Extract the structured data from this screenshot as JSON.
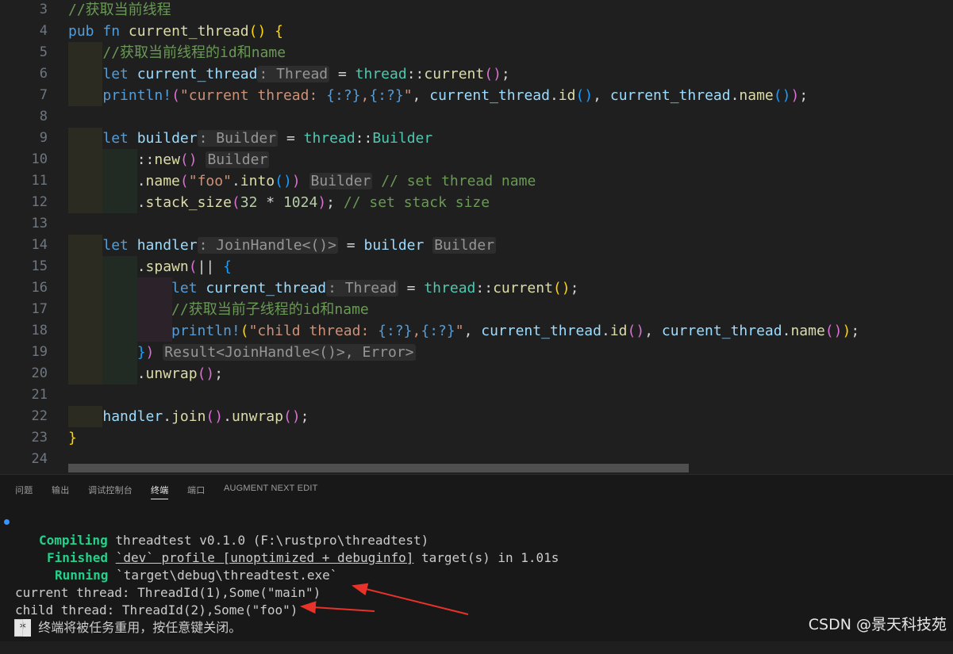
{
  "editor": {
    "lines": [
      {
        "n": "3",
        "tokens": [
          {
            "t": "//获取当前线程",
            "c": "cm"
          }
        ]
      },
      {
        "n": "4",
        "tokens": [
          {
            "t": "pub",
            "c": "kw"
          },
          {
            "t": " ",
            "c": "op"
          },
          {
            "t": "fn",
            "c": "kw"
          },
          {
            "t": " ",
            "c": "op"
          },
          {
            "t": "current_thread",
            "c": "fn"
          },
          {
            "t": "()",
            "c": "p1"
          },
          {
            "t": " ",
            "c": "op"
          },
          {
            "t": "{",
            "c": "p1"
          }
        ]
      },
      {
        "n": "5",
        "guides": 1,
        "tokens": [
          {
            "t": "    ",
            "c": "op"
          },
          {
            "t": "//获取当前线程的id和name",
            "c": "cm"
          }
        ]
      },
      {
        "n": "6",
        "guides": 1,
        "tokens": [
          {
            "t": "    ",
            "c": "op"
          },
          {
            "t": "let",
            "c": "kw"
          },
          {
            "t": " ",
            "c": "op"
          },
          {
            "t": "current_thread",
            "c": "var"
          },
          {
            "t": ": Thread",
            "c": "hint"
          },
          {
            "t": " = ",
            "c": "op"
          },
          {
            "t": "thread",
            "c": "ty"
          },
          {
            "t": "::",
            "c": "op"
          },
          {
            "t": "current",
            "c": "fn"
          },
          {
            "t": "()",
            "c": "p2"
          },
          {
            "t": ";",
            "c": "op"
          }
        ]
      },
      {
        "n": "7",
        "guides": 1,
        "tokens": [
          {
            "t": "    ",
            "c": "op"
          },
          {
            "t": "println!",
            "c": "mac"
          },
          {
            "t": "(",
            "c": "p2"
          },
          {
            "t": "\"current thread: ",
            "c": "str"
          },
          {
            "t": "{:?}",
            "c": "kw"
          },
          {
            "t": ",",
            "c": "str"
          },
          {
            "t": "{:?}",
            "c": "kw"
          },
          {
            "t": "\"",
            "c": "str"
          },
          {
            "t": ", ",
            "c": "op"
          },
          {
            "t": "current_thread",
            "c": "var"
          },
          {
            "t": ".",
            "c": "op"
          },
          {
            "t": "id",
            "c": "fn"
          },
          {
            "t": "()",
            "c": "p3"
          },
          {
            "t": ", ",
            "c": "op"
          },
          {
            "t": "current_thread",
            "c": "var"
          },
          {
            "t": ".",
            "c": "op"
          },
          {
            "t": "name",
            "c": "fn"
          },
          {
            "t": "()",
            "c": "p3"
          },
          {
            "t": ")",
            "c": "p2"
          },
          {
            "t": ";",
            "c": "op"
          }
        ]
      },
      {
        "n": "8",
        "tokens": []
      },
      {
        "n": "9",
        "guides": 1,
        "tokens": [
          {
            "t": "    ",
            "c": "op"
          },
          {
            "t": "let",
            "c": "kw"
          },
          {
            "t": " ",
            "c": "op"
          },
          {
            "t": "builder",
            "c": "var"
          },
          {
            "t": ": Builder",
            "c": "hint"
          },
          {
            "t": " = ",
            "c": "op"
          },
          {
            "t": "thread",
            "c": "ty"
          },
          {
            "t": "::",
            "c": "op"
          },
          {
            "t": "Builder",
            "c": "ty"
          }
        ]
      },
      {
        "n": "10",
        "guides": 2,
        "tokens": [
          {
            "t": "        ",
            "c": "op"
          },
          {
            "t": "::",
            "c": "op"
          },
          {
            "t": "new",
            "c": "fn"
          },
          {
            "t": "()",
            "c": "p2"
          },
          {
            "t": " ",
            "c": "op"
          },
          {
            "t": "Builder",
            "c": "hint"
          }
        ]
      },
      {
        "n": "11",
        "guides": 2,
        "tokens": [
          {
            "t": "        ",
            "c": "op"
          },
          {
            "t": ".",
            "c": "op"
          },
          {
            "t": "name",
            "c": "fn"
          },
          {
            "t": "(",
            "c": "p2"
          },
          {
            "t": "\"foo\"",
            "c": "str"
          },
          {
            "t": ".",
            "c": "op"
          },
          {
            "t": "into",
            "c": "fn"
          },
          {
            "t": "()",
            "c": "p3"
          },
          {
            "t": ")",
            "c": "p2"
          },
          {
            "t": " ",
            "c": "op"
          },
          {
            "t": "Builder",
            "c": "hint"
          },
          {
            "t": " // set thread name",
            "c": "cm"
          }
        ]
      },
      {
        "n": "12",
        "guides": 2,
        "tokens": [
          {
            "t": "        ",
            "c": "op"
          },
          {
            "t": ".",
            "c": "op"
          },
          {
            "t": "stack_size",
            "c": "fn"
          },
          {
            "t": "(",
            "c": "p2"
          },
          {
            "t": "32",
            "c": "num"
          },
          {
            "t": " * ",
            "c": "op"
          },
          {
            "t": "1024",
            "c": "num"
          },
          {
            "t": ")",
            "c": "p2"
          },
          {
            "t": "; ",
            "c": "op"
          },
          {
            "t": "// set stack size",
            "c": "cm"
          }
        ]
      },
      {
        "n": "13",
        "tokens": []
      },
      {
        "n": "14",
        "guides": 1,
        "tokens": [
          {
            "t": "    ",
            "c": "op"
          },
          {
            "t": "let",
            "c": "kw"
          },
          {
            "t": " ",
            "c": "op"
          },
          {
            "t": "handler",
            "c": "var"
          },
          {
            "t": ": JoinHandle<()>",
            "c": "hint"
          },
          {
            "t": " = ",
            "c": "op"
          },
          {
            "t": "builder",
            "c": "var"
          },
          {
            "t": " ",
            "c": "op"
          },
          {
            "t": "Builder",
            "c": "hint"
          }
        ]
      },
      {
        "n": "15",
        "guides": 2,
        "tokens": [
          {
            "t": "        ",
            "c": "op"
          },
          {
            "t": ".",
            "c": "op"
          },
          {
            "t": "spawn",
            "c": "fn"
          },
          {
            "t": "(",
            "c": "p2"
          },
          {
            "t": "||",
            "c": "op"
          },
          {
            "t": " ",
            "c": "op"
          },
          {
            "t": "{",
            "c": "p3"
          }
        ]
      },
      {
        "n": "16",
        "guides": 3,
        "tokens": [
          {
            "t": "            ",
            "c": "op"
          },
          {
            "t": "let",
            "c": "kw"
          },
          {
            "t": " ",
            "c": "op"
          },
          {
            "t": "current_thread",
            "c": "var"
          },
          {
            "t": ": Thread",
            "c": "hint"
          },
          {
            "t": " = ",
            "c": "op"
          },
          {
            "t": "thread",
            "c": "ty"
          },
          {
            "t": "::",
            "c": "op"
          },
          {
            "t": "current",
            "c": "fn"
          },
          {
            "t": "()",
            "c": "p1"
          },
          {
            "t": ";",
            "c": "op"
          }
        ]
      },
      {
        "n": "17",
        "guides": 3,
        "tokens": [
          {
            "t": "            ",
            "c": "op"
          },
          {
            "t": "//获取当前子线程的id和name",
            "c": "cm"
          }
        ]
      },
      {
        "n": "18",
        "guides": 3,
        "tokens": [
          {
            "t": "            ",
            "c": "op"
          },
          {
            "t": "println!",
            "c": "mac"
          },
          {
            "t": "(",
            "c": "p1"
          },
          {
            "t": "\"child thread: ",
            "c": "str"
          },
          {
            "t": "{:?}",
            "c": "kw"
          },
          {
            "t": ",",
            "c": "str"
          },
          {
            "t": "{:?}",
            "c": "kw"
          },
          {
            "t": "\"",
            "c": "str"
          },
          {
            "t": ", ",
            "c": "op"
          },
          {
            "t": "current_thread",
            "c": "var"
          },
          {
            "t": ".",
            "c": "op"
          },
          {
            "t": "id",
            "c": "fn"
          },
          {
            "t": "()",
            "c": "p2"
          },
          {
            "t": ", ",
            "c": "op"
          },
          {
            "t": "current_thread",
            "c": "var"
          },
          {
            "t": ".",
            "c": "op"
          },
          {
            "t": "name",
            "c": "fn"
          },
          {
            "t": "()",
            "c": "p2"
          },
          {
            "t": ")",
            "c": "p1"
          },
          {
            "t": ";",
            "c": "op"
          }
        ]
      },
      {
        "n": "19",
        "guides": 2,
        "tokens": [
          {
            "t": "        ",
            "c": "op"
          },
          {
            "t": "}",
            "c": "p3"
          },
          {
            "t": ")",
            "c": "p2"
          },
          {
            "t": " ",
            "c": "op"
          },
          {
            "t": "Result<JoinHandle<()>, Error>",
            "c": "hint"
          }
        ]
      },
      {
        "n": "20",
        "guides": 2,
        "tokens": [
          {
            "t": "        ",
            "c": "op"
          },
          {
            "t": ".",
            "c": "op"
          },
          {
            "t": "unwrap",
            "c": "fn"
          },
          {
            "t": "()",
            "c": "p2"
          },
          {
            "t": ";",
            "c": "op"
          }
        ]
      },
      {
        "n": "21",
        "tokens": []
      },
      {
        "n": "22",
        "guides": 1,
        "tokens": [
          {
            "t": "    ",
            "c": "op"
          },
          {
            "t": "handler",
            "c": "var"
          },
          {
            "t": ".",
            "c": "op"
          },
          {
            "t": "join",
            "c": "fn"
          },
          {
            "t": "()",
            "c": "p2"
          },
          {
            "t": ".",
            "c": "op"
          },
          {
            "t": "unwrap",
            "c": "fn"
          },
          {
            "t": "()",
            "c": "p2"
          },
          {
            "t": ";",
            "c": "op"
          }
        ]
      },
      {
        "n": "23",
        "tokens": [
          {
            "t": "}",
            "c": "p1"
          }
        ]
      },
      {
        "n": "24",
        "tokens": []
      }
    ]
  },
  "panel": {
    "tabs": [
      {
        "label": "问题",
        "active": false
      },
      {
        "label": "输出",
        "active": false
      },
      {
        "label": "调试控制台",
        "active": false
      },
      {
        "label": "终端",
        "active": true
      },
      {
        "label": "端口",
        "active": false
      },
      {
        "label": "AUGMENT NEXT EDIT",
        "active": false
      }
    ]
  },
  "terminal": {
    "compiling_label": "Compiling",
    "compiling_text": " threadtest v0.1.0 (F:\\rustpro\\threadtest)",
    "finished_label": "Finished",
    "finished_profile": "`dev` profile [unoptimized + debuginfo]",
    "finished_rest": " target(s) in 1.01s",
    "running_label": "Running",
    "running_text": " `target\\debug\\threadtest.exe`",
    "output_line_1": "current thread: ThreadId(1),Some(\"main\")",
    "output_line_2": "child thread: ThreadId(2),Some(\"foo\")",
    "prompt_star": "*",
    "prompt_text": " 终端将被任务重用，按任意键关闭。"
  },
  "watermark": "CSDN @景天科技苑",
  "colors": {
    "annotation_arrow": "#e8322a",
    "terminal_green": "#23d18b",
    "status_dot": "#3794ff"
  }
}
